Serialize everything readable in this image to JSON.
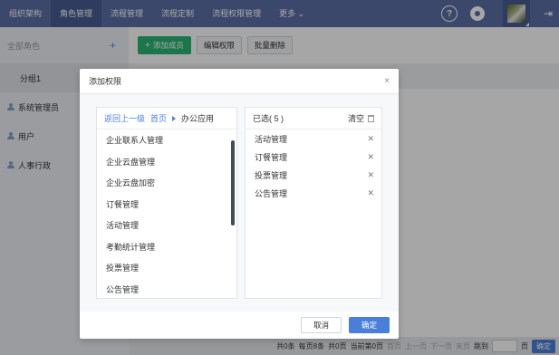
{
  "nav": {
    "items": [
      "组织架构",
      "角色管理",
      "流程管理",
      "流程定制",
      "流程权限管理",
      "更多 ⌄"
    ],
    "active_index": 1,
    "help_icon": "?",
    "logout_icon": "⇥"
  },
  "sidebar": {
    "header": "全部角色",
    "add_icon": "+",
    "group_label": "分组1",
    "roles": [
      "系统管理员",
      "用户",
      "人事行政"
    ]
  },
  "toolbar": {
    "add_member": "添加成员",
    "edit_permission": "编辑权限",
    "batch_delete": "批量删除"
  },
  "pager": {
    "total_items": "共0条",
    "per_page": "每页8条",
    "total_pages": "共0页",
    "current_page": "当前第0页",
    "first": "首页",
    "prev": "上一页",
    "next": "下一页",
    "last": "末页",
    "jump": "跳到",
    "page_unit": "页",
    "go": "确定"
  },
  "modal": {
    "title": "添加权限",
    "close_icon": "×",
    "breadcrumb": {
      "back": "返回上一级",
      "home": "首页",
      "current": "办公应用"
    },
    "available": [
      "企业联系人管理",
      "企业云盘管理",
      "企业云盘加密",
      "订餐管理",
      "活动管理",
      "考勤统计管理",
      "投票管理",
      "公告管理"
    ],
    "selected_title": "已选( 5 )",
    "clear_label": "清空",
    "selected": [
      "活动管理",
      "订餐管理",
      "投票管理",
      "公告管理"
    ],
    "cancel": "取消",
    "confirm": "确定"
  }
}
